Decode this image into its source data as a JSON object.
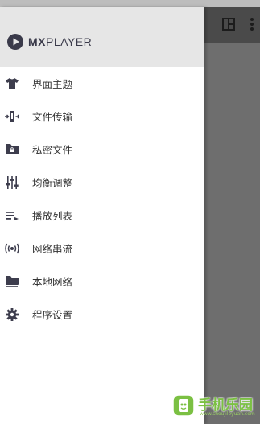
{
  "app": {
    "brand_prefix": "MX",
    "brand_suffix": "PLAYER",
    "accent_color": "#3a3a4a"
  },
  "drawer": {
    "items": [
      {
        "icon": "shirt-icon",
        "label": "界面主题"
      },
      {
        "icon": "file-transfer-icon",
        "label": "文件传输"
      },
      {
        "icon": "private-folder-icon",
        "label": "私密文件"
      },
      {
        "icon": "equalizer-icon",
        "label": "均衡调整"
      },
      {
        "icon": "playlist-icon",
        "label": "播放列表"
      },
      {
        "icon": "network-stream-icon",
        "label": "网络串流"
      },
      {
        "icon": "local-network-icon",
        "label": "本地网络"
      },
      {
        "icon": "settings-gear-icon",
        "label": "程序设置"
      }
    ]
  },
  "background_toolbar": {
    "icons": [
      "view-mode-icon",
      "more-vert-icon"
    ]
  },
  "watermark": {
    "text": "手机乐园",
    "sub": "www.shoujileyuan.com",
    "color": "#7bc043"
  }
}
